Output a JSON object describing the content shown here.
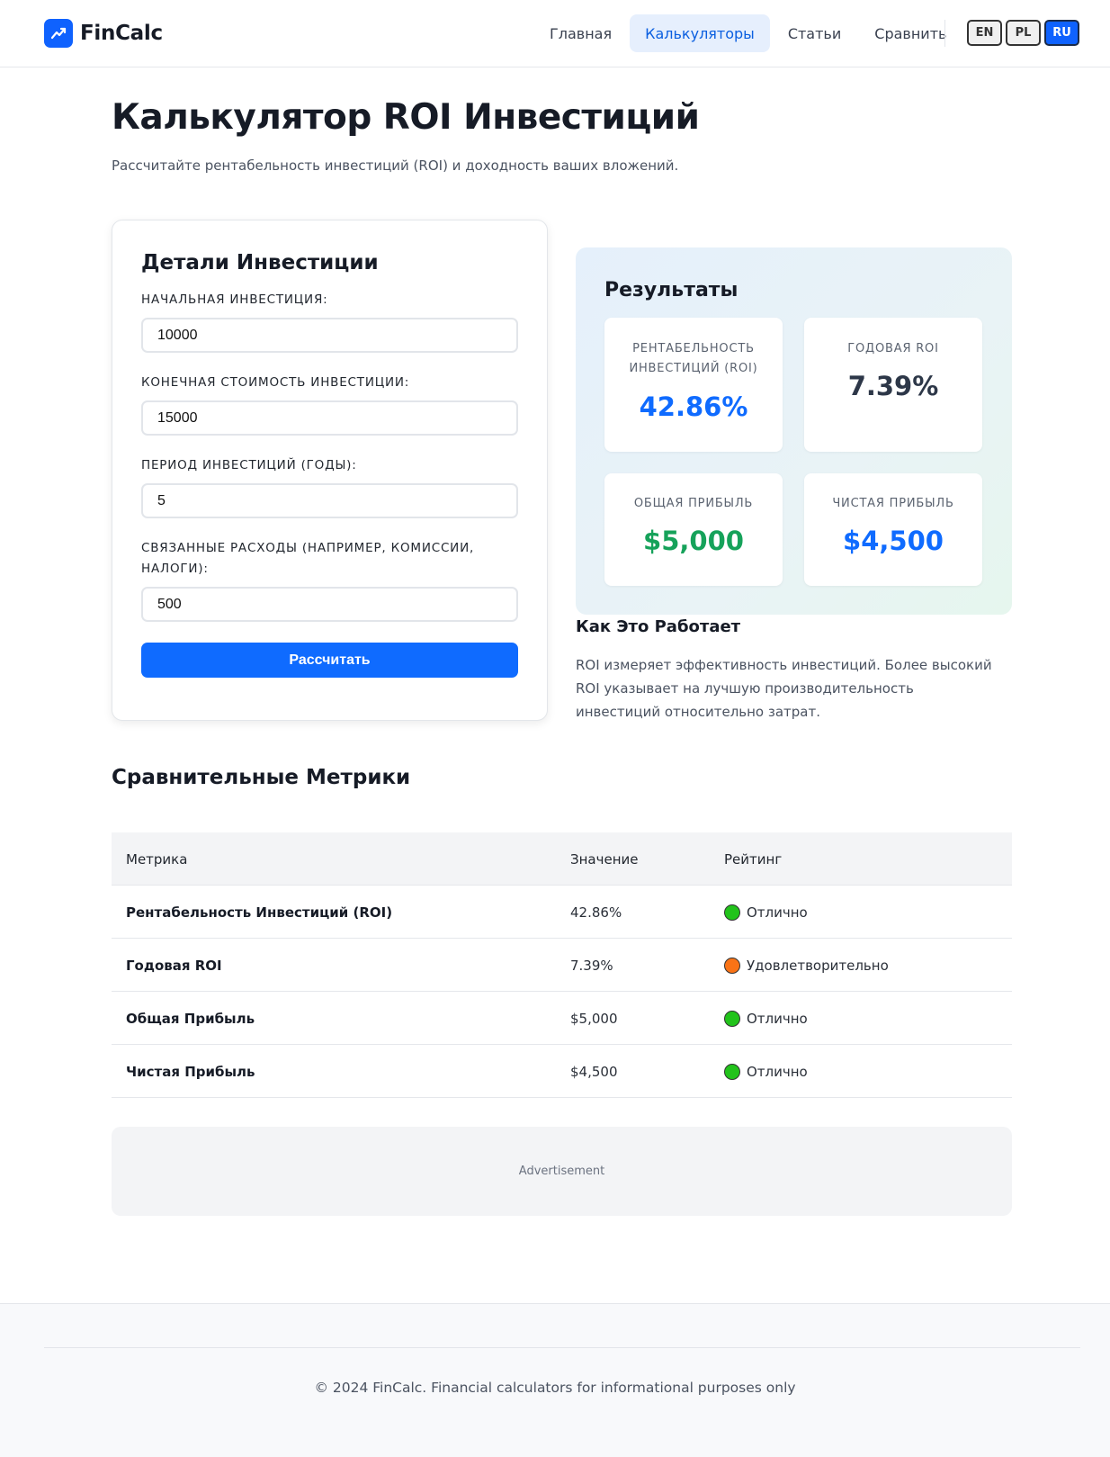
{
  "brand": {
    "name": "FinCalc",
    "color": "#0f62fe"
  },
  "nav": {
    "items": [
      {
        "label": "Главная",
        "active": false
      },
      {
        "label": "Калькуляторы",
        "active": true
      },
      {
        "label": "Статьи",
        "active": false
      },
      {
        "label": "Сравнить",
        "active": false
      }
    ],
    "languages": [
      {
        "label": "EN",
        "active": false
      },
      {
        "label": "PL",
        "active": false
      },
      {
        "label": "RU",
        "active": true
      }
    ]
  },
  "page": {
    "title": "Калькулятор ROI Инвестиций",
    "subtitle": "Рассчитайте рентабельность инвестиций (ROI) и доходность ваших вложений."
  },
  "form": {
    "title": "Детали Инвестиции",
    "fields": [
      {
        "label": "Начальная инвестиция:",
        "value": "10000"
      },
      {
        "label": "Конечная стоимость инвестиции:",
        "value": "15000"
      },
      {
        "label": "Период инвестиций (годы):",
        "value": "5"
      },
      {
        "label": "Связанные расходы (например, комиссии, налоги):",
        "value": "500"
      }
    ],
    "button_label": "Рассчитать"
  },
  "results": {
    "title": "Результаты",
    "items": [
      {
        "label": "Рентабельность инвестиций (ROI)",
        "value": "42.86%",
        "color": "#0f6bff"
      },
      {
        "label": "Годовая ROI",
        "value": "7.39%",
        "color": "#2d3748"
      },
      {
        "label": "Общая прибыль",
        "value": "$5,000",
        "color": "#16a25a"
      },
      {
        "label": "Чистая прибыль",
        "value": "$4,500",
        "color": "#0f6bff"
      }
    ]
  },
  "how": {
    "title": "Как Это Работает",
    "text": "ROI измеряет эффективность инвестиций. Более высокий ROI указывает на лучшую производительность инвестиций относительно затрат."
  },
  "comparison": {
    "title": "Сравнительные Метрики",
    "headers": [
      "Метрика",
      "Значение",
      "Рейтинг"
    ],
    "rows": [
      {
        "metric": "Рентабельность Инвестиций (ROI)",
        "value": "42.86%",
        "rating": "Отлично",
        "color": "#22c31b"
      },
      {
        "metric": "Годовая ROI",
        "value": "7.39%",
        "rating": "Удовлетворительно",
        "color": "#f97316"
      },
      {
        "metric": "Общая Прибыль",
        "value": "$5,000",
        "rating": "Отлично",
        "color": "#22c31b"
      },
      {
        "metric": "Чистая Прибыль",
        "value": "$4,500",
        "rating": "Отлично",
        "color": "#22c31b"
      }
    ]
  },
  "ad": {
    "label": "Advertisement"
  },
  "footer": {
    "text": "© 2024 FinCalc. Financial calculators for informational purposes only"
  }
}
